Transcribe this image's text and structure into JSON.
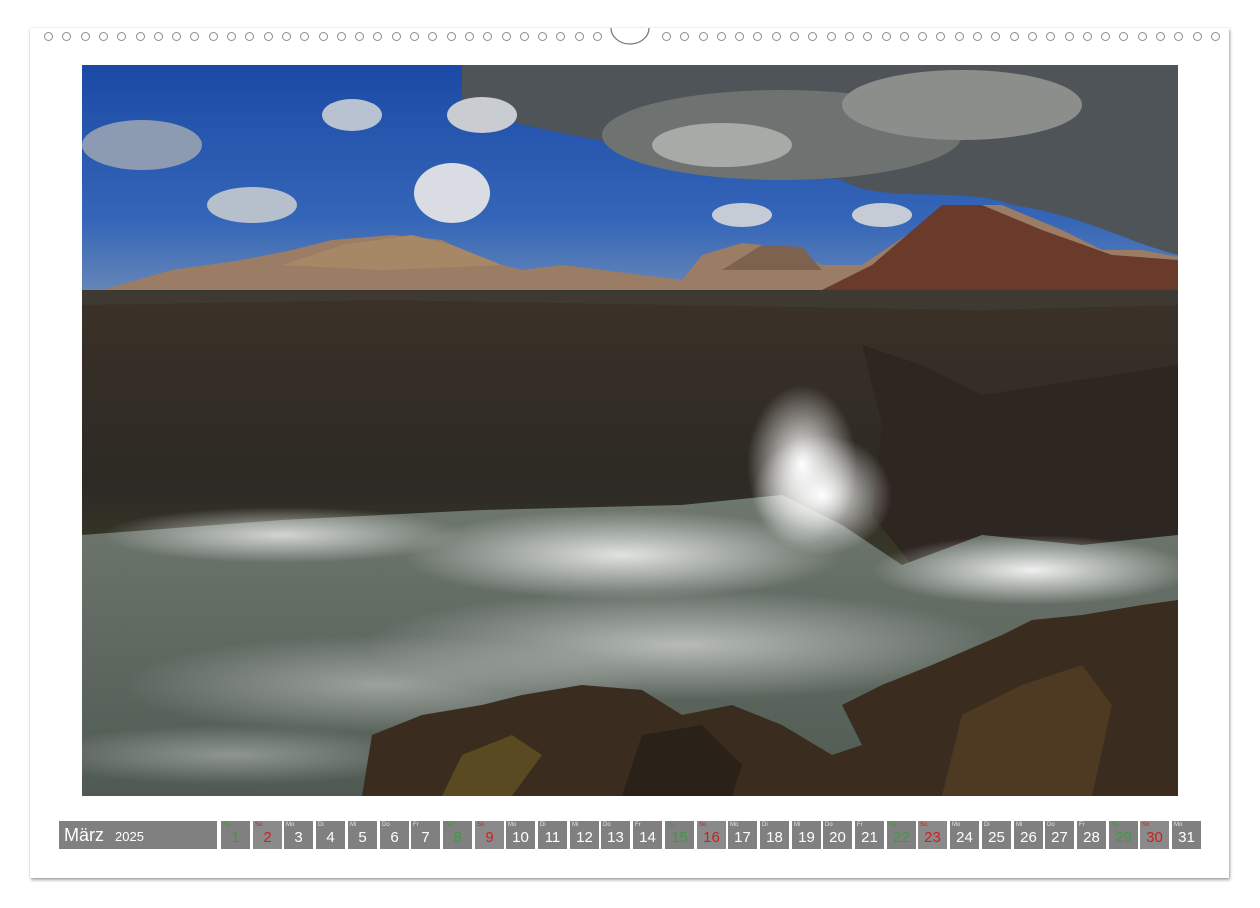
{
  "calendar": {
    "month": "März",
    "year": "2025",
    "days": [
      {
        "wd": "Sa",
        "num": "1",
        "type": "greenday"
      },
      {
        "wd": "So",
        "num": "2",
        "type": "sun"
      },
      {
        "wd": "Mo",
        "num": "3",
        "type": "week"
      },
      {
        "wd": "Di",
        "num": "4",
        "type": "week"
      },
      {
        "wd": "Mi",
        "num": "5",
        "type": "week"
      },
      {
        "wd": "Do",
        "num": "6",
        "type": "week"
      },
      {
        "wd": "Fr",
        "num": "7",
        "type": "week"
      },
      {
        "wd": "Sa",
        "num": "8",
        "type": "greenday"
      },
      {
        "wd": "So",
        "num": "9",
        "type": "sun"
      },
      {
        "wd": "Mo",
        "num": "10",
        "type": "week"
      },
      {
        "wd": "Di",
        "num": "11",
        "type": "week"
      },
      {
        "wd": "Mi",
        "num": "12",
        "type": "week"
      },
      {
        "wd": "Do",
        "num": "13",
        "type": "week"
      },
      {
        "wd": "Fr",
        "num": "14",
        "type": "week"
      },
      {
        "wd": "Sa",
        "num": "15",
        "type": "greenday"
      },
      {
        "wd": "So",
        "num": "16",
        "type": "sun"
      },
      {
        "wd": "Mo",
        "num": "17",
        "type": "week"
      },
      {
        "wd": "Di",
        "num": "18",
        "type": "week"
      },
      {
        "wd": "Mi",
        "num": "19",
        "type": "week"
      },
      {
        "wd": "Do",
        "num": "20",
        "type": "week"
      },
      {
        "wd": "Fr",
        "num": "21",
        "type": "week"
      },
      {
        "wd": "Sa",
        "num": "22",
        "type": "greenday"
      },
      {
        "wd": "So",
        "num": "23",
        "type": "sun"
      },
      {
        "wd": "Mo",
        "num": "24",
        "type": "week"
      },
      {
        "wd": "Di",
        "num": "25",
        "type": "week"
      },
      {
        "wd": "Mi",
        "num": "26",
        "type": "week"
      },
      {
        "wd": "Do",
        "num": "27",
        "type": "week"
      },
      {
        "wd": "Fr",
        "num": "28",
        "type": "week"
      },
      {
        "wd": "Sa",
        "num": "29",
        "type": "greenday"
      },
      {
        "wd": "So",
        "num": "30",
        "type": "sun"
      },
      {
        "wd": "Mo",
        "num": "31",
        "type": "week"
      }
    ]
  },
  "colors": {
    "day_box": "#808080",
    "sunday_text": "#cc2020",
    "saturday_text": "#3f9a3f"
  },
  "photo": {
    "icon": "coastal-landscape-image"
  }
}
